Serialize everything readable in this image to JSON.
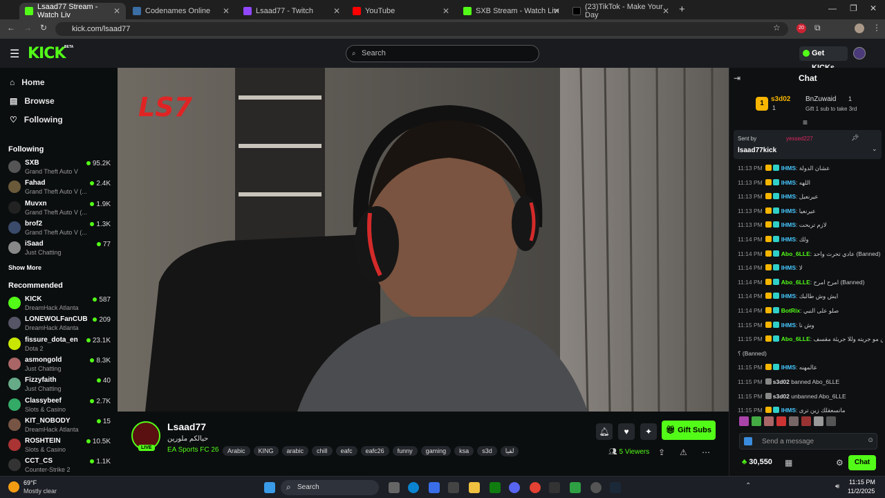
{
  "browser": {
    "tabs": [
      {
        "title": "Lsaad77 Stream - Watch Liv",
        "color": "#53fc18",
        "active": true
      },
      {
        "title": "Codenames Online",
        "color": "#3a6ea5",
        "active": false
      },
      {
        "title": "Lsaad77 - Twitch",
        "color": "#9146ff",
        "active": false
      },
      {
        "title": "YouTube",
        "color": "#ff0000",
        "active": false
      },
      {
        "title": "SXB Stream - Watch Live on Kic",
        "color": "#53fc18",
        "active": false
      },
      {
        "title": "(23)TikTok - Make Your Day",
        "color": "#000000",
        "active": false
      }
    ],
    "url": "kick.com/lsaad77",
    "ext_badge": "20"
  },
  "header": {
    "logo": "KICK",
    "logo_beta": "BETA",
    "search_placeholder": "Search",
    "get_kicks": "Get KICKs"
  },
  "nav": {
    "home": "Home",
    "browse": "Browse",
    "following": "Following"
  },
  "following_title": "Following",
  "following": [
    {
      "name": "SXB",
      "game": "Grand Theft Auto V",
      "viewers": "95.2K",
      "color": "#555"
    },
    {
      "name": "Fahad",
      "game": "Grand Theft Auto V (...",
      "viewers": "2.4K",
      "color": "#6a5a3a"
    },
    {
      "name": "Muvxn",
      "game": "Grand Theft Auto V (...",
      "viewers": "1.9K",
      "color": "#222"
    },
    {
      "name": "brof2",
      "game": "Grand Theft Auto V (...",
      "viewers": "1.3K",
      "color": "#3a4a6a"
    },
    {
      "name": "iSaad",
      "game": "Just Chatting",
      "viewers": "77",
      "color": "#888"
    }
  ],
  "show_more": "Show More",
  "recommended_title": "Recommended",
  "recommended": [
    {
      "name": "KICK",
      "game": "DreamHack Atlanta",
      "viewers": "587",
      "color": "#53fc18"
    },
    {
      "name": "LONEWOLFanCUB",
      "game": "DreamHack Atlanta",
      "viewers": "209",
      "color": "#556"
    },
    {
      "name": "fissure_dota_en",
      "game": "Dota 2",
      "viewers": "23.1K",
      "color": "#c8e600"
    },
    {
      "name": "asmongold",
      "game": "Just Chatting",
      "viewers": "8.3K",
      "color": "#a66"
    },
    {
      "name": "Fizzyfaith",
      "game": "Just Chatting",
      "viewers": "40",
      "color": "#6a8"
    },
    {
      "name": "Classybeef",
      "game": "Slots & Casino",
      "viewers": "2.7K",
      "color": "#3a6"
    },
    {
      "name": "KIT_NOBODY",
      "game": "DreamHack Atlanta",
      "viewers": "15",
      "color": "#754"
    },
    {
      "name": "ROSHTEIN",
      "game": "Slots & Casino",
      "viewers": "10.5K",
      "color": "#a33"
    },
    {
      "name": "CCT_CS",
      "game": "Counter-Strike 2",
      "viewers": "1.1K",
      "color": "#333"
    }
  ],
  "video": {
    "overlay_logo": "LS7"
  },
  "stream": {
    "name": "Lsaad77",
    "title": "حيالكم ملورين",
    "category": "EA Sports FC 26",
    "live": "LIVE",
    "tags": [
      "Arabic",
      "KING",
      "arabic",
      "chill",
      "eafc",
      "eafc26",
      "funny",
      "gaming",
      "ksa",
      "s3d",
      "لقيا"
    ],
    "viewers": "5 Viewers",
    "gift_subs": "Gift Subs"
  },
  "chat": {
    "title": "Chat",
    "top_gifter": {
      "rank": "1",
      "name": "s3d02",
      "count": "1"
    },
    "second": {
      "name": "BnZuwaid",
      "count": "1"
    },
    "gift_hint": "Gift 1 sub to take 3rd",
    "pinned": {
      "sent_by": "Sent by",
      "sender": "yessed227",
      "text": "lsaad77kick"
    },
    "messages": [
      {
        "time": "11:13 PM",
        "user": "IHMS",
        "text": "عشان الدولة",
        "style": "u2"
      },
      {
        "time": "11:13 PM",
        "user": "IHMS",
        "text": "اللهه",
        "style": "u2"
      },
      {
        "time": "11:13 PM",
        "user": "IHMS",
        "text": "عيرنعيل",
        "style": "u2"
      },
      {
        "time": "11:13 PM",
        "user": "IHMS",
        "text": "عيرنعيا",
        "style": "u2"
      },
      {
        "time": "11:13 PM",
        "user": "IHMS",
        "text": "لازم تربحت",
        "style": "u2"
      },
      {
        "time": "11:14 PM",
        "user": "IHMS",
        "text": "ولك",
        "style": "u2"
      },
      {
        "time": "11:14 PM",
        "user": "Abo_6LLE",
        "text": "عادي تحرث واحد (Banned)",
        "style": "u"
      },
      {
        "time": "11:14 PM",
        "user": "IHMS",
        "text": "لا",
        "style": "u2"
      },
      {
        "time": "11:14 PM",
        "user": "Abo_6LLE",
        "text": "امرح امرح (Banned)",
        "style": "u"
      },
      {
        "time": "11:14 PM",
        "user": "IHMS",
        "text": "ايش وش طالبك",
        "style": "u2"
      },
      {
        "time": "11:14 PM",
        "user": "BotRix",
        "text": "صلو على النبي",
        "style": "u"
      },
      {
        "time": "11:15 PM",
        "user": "IHMS",
        "text": "وش نا",
        "style": "u2"
      },
      {
        "time": "11:15 PM",
        "user": "Abo_6LLE",
        "text": "الحين مو جريته وللا جريئة مقسف",
        "style": "u"
      },
      {
        "time": "",
        "user": "",
        "text": "؟ (Banned)",
        "style": "u"
      },
      {
        "time": "11:15 PM",
        "user": "IHMS",
        "text": "عالمهنه",
        "style": "u2"
      },
      {
        "time": "11:15 PM",
        "user": "s3d02",
        "text": "banned Abo_6LLE",
        "style": "sys"
      },
      {
        "time": "11:15 PM",
        "user": "s3d02",
        "text": "unbanned Abo_6LLE",
        "style": "sys"
      },
      {
        "time": "11:15 PM",
        "user": "IHMS",
        "text": "ماتسعقلك زين ترى",
        "style": "u2"
      }
    ],
    "input_placeholder": "Send a message",
    "points": "30,550",
    "chat_button": "Chat"
  },
  "taskbar": {
    "temp": "69°F",
    "weather": "Mostly clear",
    "search": "Search",
    "time": "11:15 PM",
    "date": "11/2/2025"
  }
}
